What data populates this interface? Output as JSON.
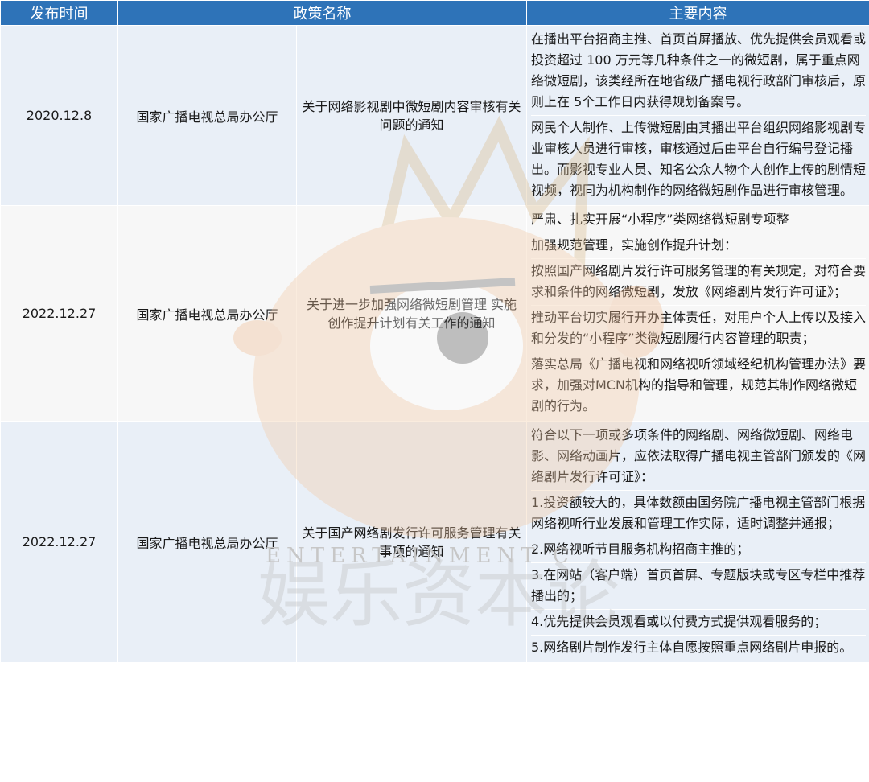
{
  "headers": [
    "发布时间",
    "政策名称",
    "主要内容"
  ],
  "rows": [
    {
      "date": "2020.12.8",
      "org": "国家广播电视总局办公厅",
      "name": "关于网络影视剧中微短剧内容审核有关问题的通知",
      "contents": [
        "在播出平台招商主推、首页首屏播放、优先提供会员观看或投资超过 100 万元等几种条件之一的微短剧，属于重点网络微短剧，该类经所在地省级广播电视行政部门审核后，原则上在 5个工作日内获得规划备案号。",
        "网民个人制作、上传微短剧由其播出平台组织网络影视剧专业审核人员进行审核，审核通过后由平台自行编号登记播出。而影视专业人员、知名公众人物个人创作上传的剧情短视频，视同为机构制作的网络微短剧作品进行审核管理。"
      ]
    },
    {
      "date": "2022.12.27",
      "org": "国家广播电视总局办公厅",
      "name": "关于进一步加强网络微短剧管理 实施创作提升计划有关工作的通知",
      "contents": [
        "严肃、扎实开展“小程序”类网络微短剧专项整",
        "加强规范管理，实施创作提升计划：",
        "按照国产网络剧片发行许可服务管理的有关规定，对符合要求和条件的网络微短剧，发放《网络剧片发行许可证》；",
        "推动平台切实履行开办主体责任，对用户个人上传以及接入和分发的“小程序”类微短剧履行内容管理的职责；",
        "落实总局《广播电视和网络视听领域经纪机构管理办法》要求，加强对MCN机构的指导和管理，规范其制作网络微短剧的行为。"
      ]
    },
    {
      "date": "2022.12.27",
      "org": "国家广播电视总局办公厅",
      "name": "关于国产网络剧发行许可服务管理有关事项的通知",
      "contents": [
        "符合以下一项或多项条件的网络剧、网络微短剧、网络电影、网络动画片，应依法取得广播电视主管部门颁发的《网络剧片发行许可证》：",
        "1.投资额较大的，具体数额由国务院广播电视主管部门根据网络视听行业发展和管理工作实际，适时调整并通报；",
        "2.网络视听节目服务机构招商主推的；",
        "3.在网站（客户端）首页首屏、专题版块或专区专栏中推荐播出的；",
        "4.优先提供会员观看或以付费方式提供观看服务的；",
        "5.网络剧片制作发行主体自愿按照重点网络剧片申报的。"
      ]
    }
  ],
  "watermark": {
    "latin": "ENTERTAINMENT C",
    "cjk": "娱乐资本论"
  },
  "colors": {
    "header": "#2e73b8",
    "band1": "#e9eff7",
    "band2": "#f7f7f7"
  }
}
